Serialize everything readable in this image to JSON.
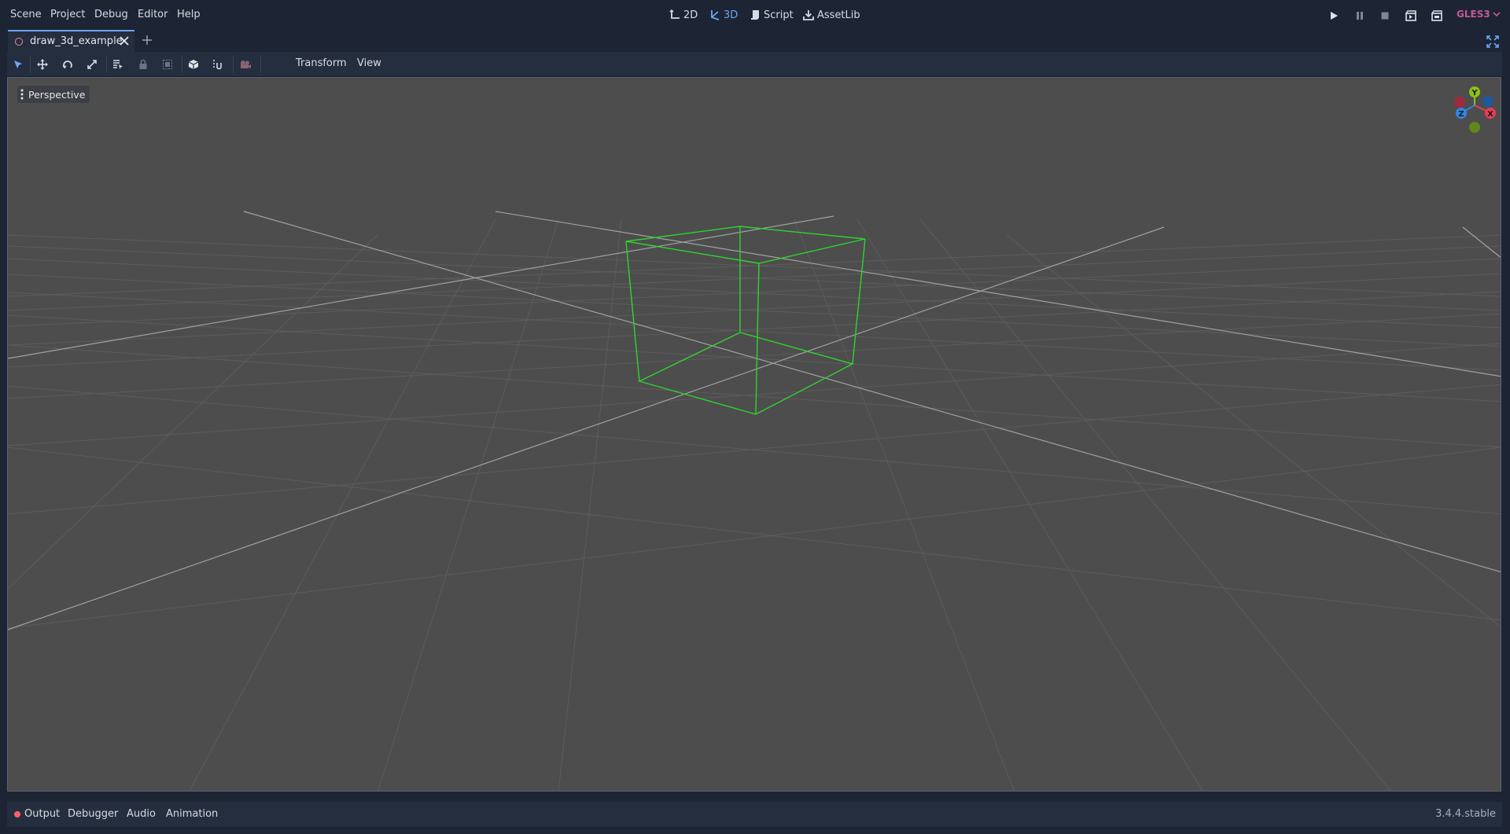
{
  "colors": {
    "background": "#1d2433",
    "panel": "#252e3e",
    "accent": "#6aa7f5",
    "viewport": "#4d4d4d",
    "cube_wireframe": "#2fd32f",
    "renderer_label": "#c25b98",
    "gizmo_x": "#ec3b57",
    "gizmo_y": "#8ac217",
    "gizmo_z": "#2f86e4"
  },
  "menu": {
    "scene": "Scene",
    "project": "Project",
    "debug": "Debug",
    "editor": "Editor",
    "help": "Help"
  },
  "workspaces": {
    "two_d": "2D",
    "three_d": "3D",
    "script": "Script",
    "assetlib": "AssetLib",
    "active": "3D"
  },
  "run_controls": {
    "icons": [
      "play-icon",
      "pause-icon",
      "stop-icon",
      "play-scene-icon",
      "play-custom-scene-icon"
    ]
  },
  "renderer": {
    "label": "GLES3"
  },
  "scene_tabs": {
    "tabs": [
      {
        "label": "draw_3d_example"
      }
    ]
  },
  "toolbar": {
    "tools": [
      "select-icon",
      "move-icon",
      "rotate-icon",
      "scale-icon",
      "list-select-icon",
      "lock-icon",
      "group-icon",
      "local-space-icon",
      "snap-icon",
      "camera-override-icon"
    ],
    "transform_menu": "Transform",
    "view_menu": "View"
  },
  "viewport": {
    "perspective_label": "Perspective",
    "gizmo": {
      "y": "Y",
      "x": "X",
      "z": "Z"
    }
  },
  "bottom_panel": {
    "output": "Output",
    "debugger": "Debugger",
    "audio": "Audio",
    "animation": "Animation",
    "version": "3.4.4.stable"
  }
}
